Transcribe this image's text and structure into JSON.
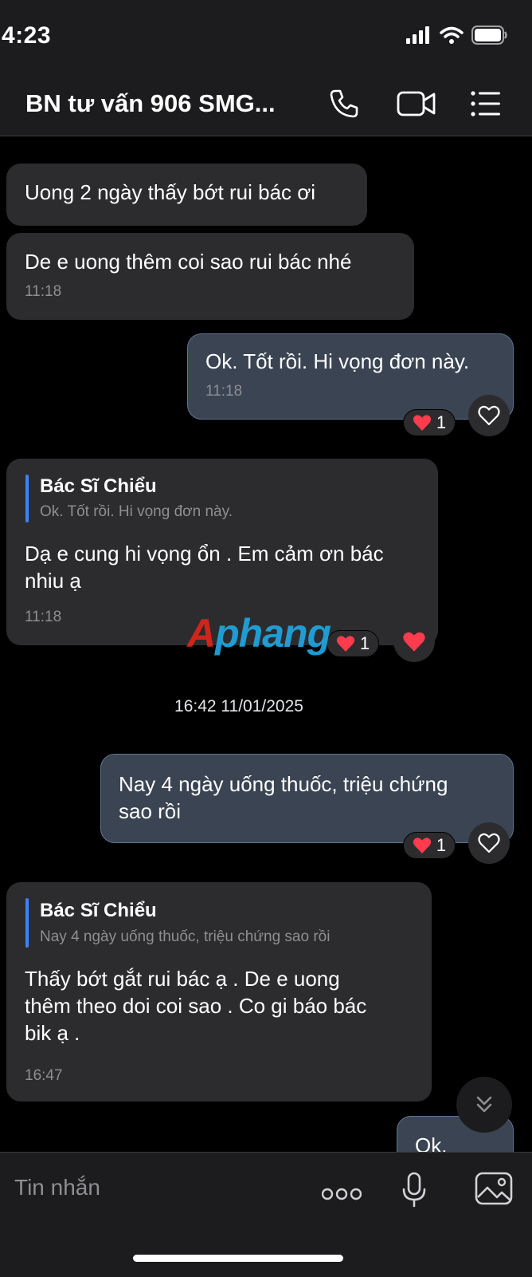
{
  "status": {
    "time": "4:23"
  },
  "header": {
    "title": "BN tư vấn 906 SMG..."
  },
  "messages": {
    "m1": {
      "text": "Uong 2 ngày thấy bớt rui bác ơi"
    },
    "m2": {
      "text": "De e uong thêm coi sao rui bác nhé",
      "time": "11:18"
    },
    "m3": {
      "text": "Ok. Tốt rồi. Hi vọng đơn này.",
      "time": "11:18",
      "reaction_count": "1"
    },
    "m4": {
      "quote_name": "Bác Sĩ Chiểu",
      "quote_text": "Ok. Tốt rồi. Hi vọng đơn này.",
      "line1": "Dạ e cung hi vọng ổn . Em cảm ơn bác",
      "line2": "nhiu ạ",
      "time": "11:18",
      "reaction_count": "1"
    },
    "date_separator": "16:42 11/01/2025",
    "m5": {
      "line1": "Nay 4 ngày uống thuốc, triệu chứng",
      "line2": "sao rồi",
      "reaction_count": "1"
    },
    "m6": {
      "quote_name": "Bác Sĩ Chiểu",
      "quote_text": "Nay 4 ngày uống thuốc, triệu chứng sao rồi",
      "line1": "Thấy bớt gắt rui bác ạ . De e uong",
      "line2": "thêm theo doi coi sao . Co gi báo bác",
      "line3": "bik ạ .",
      "time": "16:47"
    },
    "m7": {
      "text": "Ok."
    }
  },
  "watermark": {
    "part1": "A",
    "part2": "phang"
  },
  "input": {
    "placeholder": "Tin nhắn"
  },
  "colors": {
    "accent": "#3e82ff",
    "heart": "#ff3b4e",
    "incoming": "#2c2c2e",
    "outgoing": "#3a4452"
  },
  "icons": [
    "signal-icon",
    "wifi-icon",
    "battery-icon",
    "phone-icon",
    "video-icon",
    "menu-icon",
    "heart-icon",
    "heart-outline-icon",
    "chevrons-down-icon",
    "more-icon",
    "microphone-icon",
    "image-icon"
  ]
}
